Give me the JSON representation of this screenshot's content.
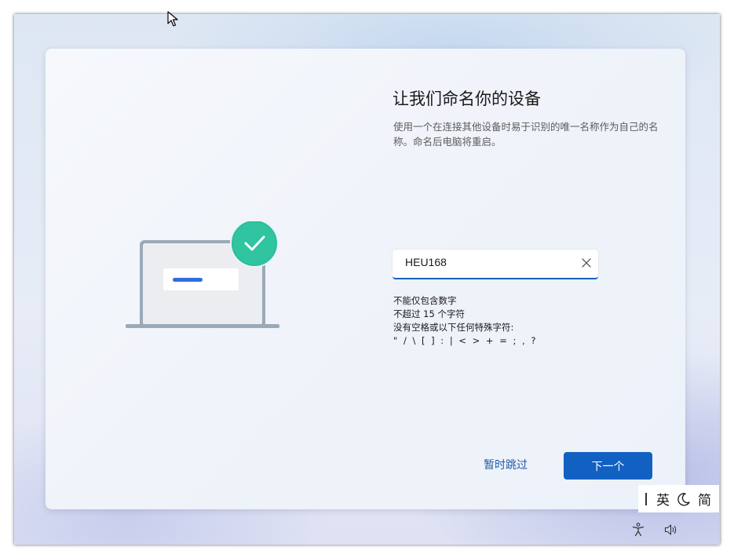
{
  "setup": {
    "title": "让我们命名你的设备",
    "description": "使用一个在连接其他设备时易于识别的唯一名称作为自己的名称。命名后电脑将重启。",
    "device_name_value": "HEU168",
    "rules": {
      "line1": "不能仅包含数字",
      "line2": "不超过 15 个字符",
      "line3": "没有空格或以下任何特殊字符:",
      "line4": "\" / \\ [ ] : | < > + = ; , ?"
    },
    "skip_label": "暂时跳过",
    "next_label": "下一个"
  },
  "ime": {
    "language": "英",
    "mode": "简"
  },
  "colors": {
    "accent": "#1261c2",
    "link": "#1d5aa8",
    "check_green": "#2ebd9d"
  },
  "icons": {
    "cursor": "mouse-pointer-icon",
    "clear": "close-icon",
    "check": "checkmark-icon",
    "moon": "moon-icon",
    "accessibility": "accessibility-icon",
    "volume": "volume-icon"
  }
}
